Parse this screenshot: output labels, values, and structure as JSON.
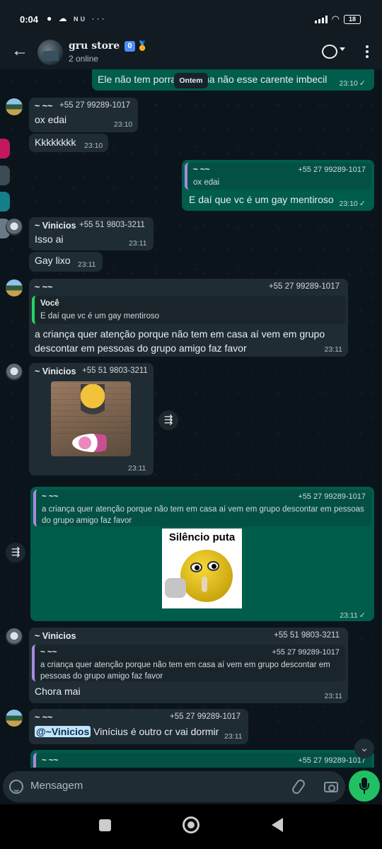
{
  "status_bar": {
    "time": "0:04",
    "notif_icons": "● ☁ ɴᴜ ···",
    "battery": "18"
  },
  "header": {
    "group_name": "gru store",
    "badge": "0",
    "medal": "🏅",
    "subtitle": "2 online"
  },
  "date_pill": "Ontem",
  "messages": [
    {
      "type": "outgoing",
      "text_left": "Ele não tem porra",
      "text_right": "na não esse carente imbecil",
      "time": "23:10",
      "check": "✓"
    },
    {
      "type": "incoming",
      "sender": "~ ~~",
      "phone": "+55 27 99289-1017",
      "text": "ox edai",
      "time": "23:10"
    },
    {
      "type": "incoming",
      "text": "Kkkkkkkk",
      "time": "23:10"
    },
    {
      "type": "outgoing",
      "quote_author": "~ ~~",
      "quote_phone": "+55 27 99289-1017",
      "quote_text": "ox edai",
      "text": "E daí que vc é um gay mentiroso",
      "time": "23:10",
      "check": "✓"
    },
    {
      "type": "incoming",
      "sender": "~ Vinicios",
      "phone": "+55 51 9803-3211",
      "text": "Isso ai",
      "time": "23:11"
    },
    {
      "type": "incoming",
      "text": "Gay lixo",
      "time": "23:11"
    },
    {
      "type": "incoming",
      "sender": "~ ~~",
      "phone": "+55 27 99289-1017",
      "quote_author": "Você",
      "quote_text": "E daí que vc é um gay mentiroso",
      "text": "a criança quer atenção porque não tem em casa aí vem em grupo descontar em pessoas do grupo amigo faz favor",
      "time": "23:11"
    },
    {
      "type": "incoming",
      "sender": "~ Vinicios",
      "phone": "+55 51 9803-3211",
      "media": "image",
      "time": "23:11",
      "forward_icon": "⇶"
    },
    {
      "type": "outgoing",
      "quote_author": "~ ~~",
      "quote_phone": "+55 27 99289-1017",
      "quote_text": "a criança quer atenção porque não tem em casa aí vem em grupo descontar em pessoas do grupo amigo faz favor",
      "sticker_caption": "Silêncio puta",
      "time": "23:11",
      "check": "✓",
      "forward_icon": "⇶"
    },
    {
      "type": "incoming",
      "sender": "~ Vinicios",
      "phone": "+55 51 9803-3211",
      "quote_author": "~ ~~",
      "quote_phone": "+55 27 99289-1017",
      "quote_text": "a criança quer atenção porque não tem em casa aí vem em grupo descontar em pessoas do grupo amigo faz favor",
      "text": "Chora mai",
      "time": "23:11"
    },
    {
      "type": "incoming",
      "sender": "~ ~~",
      "phone": "+55 27 99289-1017",
      "mention": "@~Vinicios",
      "text": "Vinícius é outro cr vai dormir",
      "time": "23:11"
    },
    {
      "type": "outgoing",
      "quote_author": "~ ~~",
      "quote_phone": "+55 27 99289-1017"
    }
  ],
  "input": {
    "placeholder": "Mensagem"
  },
  "colors": {
    "outgoing_bubble": "#005c4b",
    "incoming_bubble": "#202c33",
    "chat_bg": "#0b141a",
    "accent": "#21c063"
  }
}
